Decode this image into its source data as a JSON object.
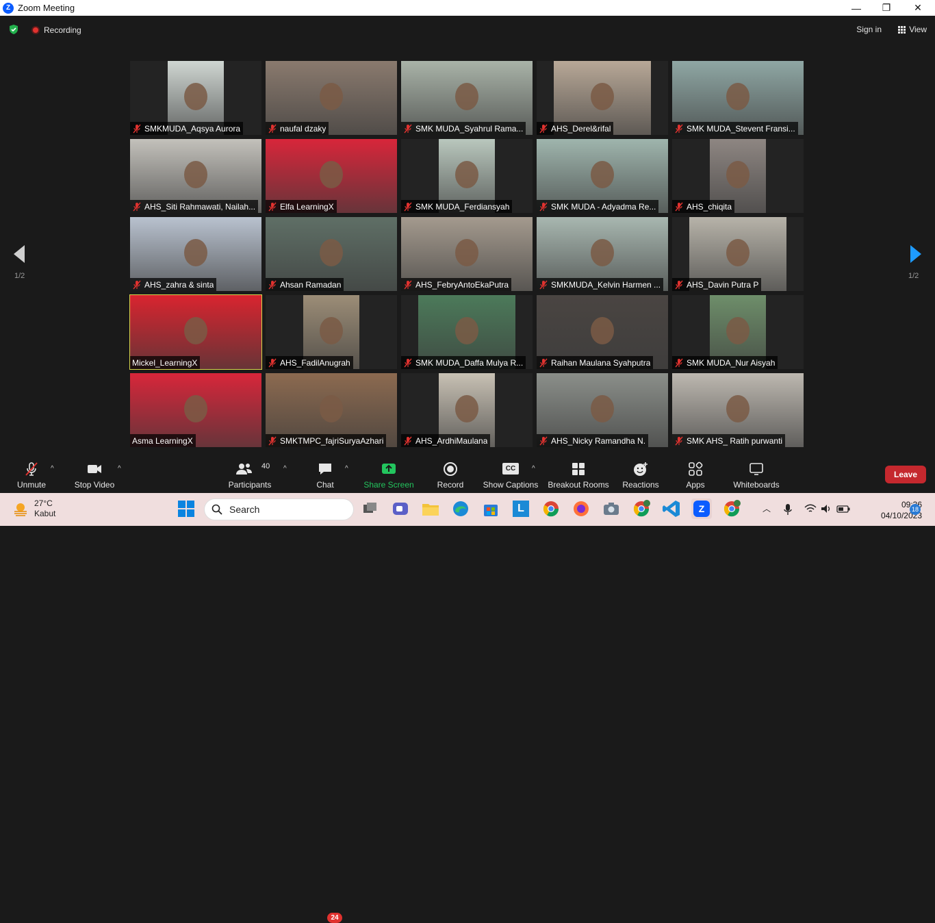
{
  "window": {
    "title": "Zoom Meeting",
    "minimize": "—",
    "restore": "❐",
    "close": "✕"
  },
  "topbar": {
    "recording_label": "Recording",
    "sign_in": "Sign in",
    "view": "View"
  },
  "gallery": {
    "page_left": "1/2",
    "page_right": "1/2",
    "tiles": [
      {
        "name": "SMKMUDA_Aqsya Aurora",
        "muted": true,
        "bg": "#cfd6d2"
      },
      {
        "name": "naufal dzaky",
        "muted": true,
        "bg": "#8a7a6e"
      },
      {
        "name": "SMK MUDA_Syahrul Rama...",
        "muted": true,
        "bg": "#a9b3a8"
      },
      {
        "name": "AHS_Derel&rifal",
        "muted": true,
        "bg": "#b8a897"
      },
      {
        "name": "SMK MUDA_Stevent Fransi...",
        "muted": true,
        "bg": "#8fa7a4"
      },
      {
        "name": "AHS_Siti Rahmawati, Nailah...",
        "muted": true,
        "bg": "#c3c1bb"
      },
      {
        "name": "Elfa LearningX",
        "muted": true,
        "bg": "#d8263a"
      },
      {
        "name": "SMK MUDA_Ferdiansyah",
        "muted": true,
        "bg": "#b9c7bd"
      },
      {
        "name": "SMK MUDA - Adyadma Re...",
        "muted": true,
        "bg": "#9fb5ad"
      },
      {
        "name": "AHS_chiqita",
        "muted": true,
        "bg": "#8e8682"
      },
      {
        "name": "AHS_zahra & sinta",
        "muted": true,
        "bg": "#b9c2cf"
      },
      {
        "name": "Ahsan Ramadan",
        "muted": true,
        "bg": "#5f6f66"
      },
      {
        "name": "AHS_FebryAntoEkaPutra",
        "muted": true,
        "bg": "#a49a8e"
      },
      {
        "name": "SMKMUDA_Kelvin Harmen ...",
        "muted": true,
        "bg": "#a8b7b0"
      },
      {
        "name": "AHS_Davin Putra P",
        "muted": true,
        "bg": "#b7b3a9"
      },
      {
        "name": "Mickel_LearningX",
        "muted": false,
        "bg": "#d9242f"
      },
      {
        "name": "AHS_FadilAnugrah",
        "muted": true,
        "bg": "#9c8d77"
      },
      {
        "name": "SMK MUDA_Daffa Mulya R...",
        "muted": true,
        "bg": "#4c7a5a"
      },
      {
        "name": "Raihan Maulana Syahputra",
        "muted": true,
        "bg": "#4a4542"
      },
      {
        "name": "SMK MUDA_Nur Aisyah",
        "muted": true,
        "bg": "#6e8e6a"
      },
      {
        "name": "Asma LearningX",
        "muted": false,
        "bg": "#d8263a"
      },
      {
        "name": "SMKTMPC_fajriSuryaAzhari",
        "muted": true,
        "bg": "#8c6a50"
      },
      {
        "name": "AHS_ArdhiMaulana",
        "muted": true,
        "bg": "#c8c1b4"
      },
      {
        "name": "AHS_Nicky Ramandha N.",
        "muted": true,
        "bg": "#8b8f8a"
      },
      {
        "name": "SMK AHS_ Ratih purwanti",
        "muted": true,
        "bg": "#bdb8b0"
      }
    ]
  },
  "toolbar": {
    "unmute": "Unmute",
    "stop_video": "Stop Video",
    "participants": "Participants",
    "participants_count": "40",
    "chat": "Chat",
    "chat_badge": "24",
    "share_screen": "Share Screen",
    "record": "Record",
    "show_captions": "Show Captions",
    "cc": "CC",
    "breakout_rooms": "Breakout Rooms",
    "reactions": "Reactions",
    "apps": "Apps",
    "whiteboards": "Whiteboards",
    "leave": "Leave",
    "caret": "^"
  },
  "taskbar": {
    "temperature": "27°C",
    "weather": "Kabut",
    "search": "Search",
    "time": "09:36",
    "date": "04/10/2023",
    "notifications": "18",
    "vscode_letter": "L",
    "chrome_badge": "k"
  }
}
